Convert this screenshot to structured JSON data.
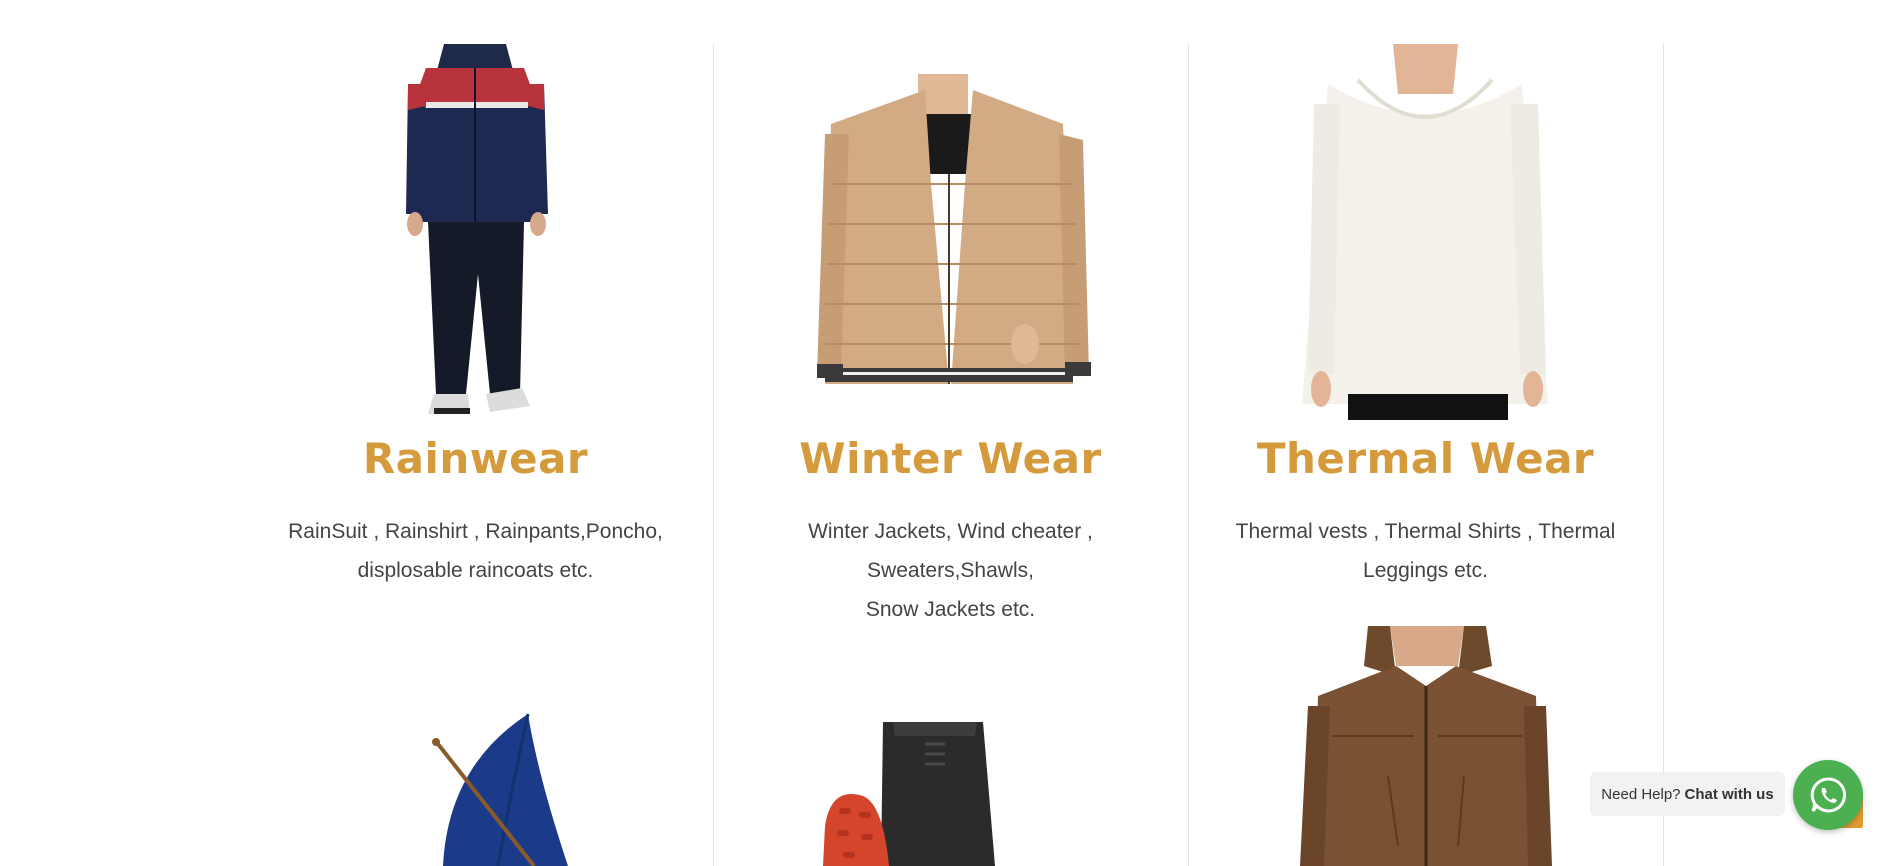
{
  "products": [
    {
      "title": "Rainwear",
      "desc_line1": "RainSuit , Rainshirt , Rainpants,Poncho,",
      "desc_line2": "displosable raincoats etc.",
      "image": "rainsuit-photo"
    },
    {
      "title": "Winter Wear",
      "desc_line1": "Winter Jackets, Wind cheater , Sweaters,Shawls,",
      "desc_line2": "Snow Jackets etc.",
      "image": "puffer-jacket-photo"
    },
    {
      "title": "Thermal Wear",
      "desc_line1": "Thermal vests , Thermal Shirts , Thermal",
      "desc_line2": "Leggings etc.",
      "image": "thermal-shirt-photo"
    },
    {
      "image": "umbrella-photo"
    },
    {
      "image": "gumboots-photo"
    },
    {
      "image": "hooded-jacket-photo"
    }
  ],
  "whatsapp": {
    "prefix": "Need Help?",
    "cta": "Chat with us",
    "icon": "whatsapp-icon"
  },
  "colors": {
    "title_accent": "#d49a3c",
    "whatsapp_green": "#4caf50"
  }
}
